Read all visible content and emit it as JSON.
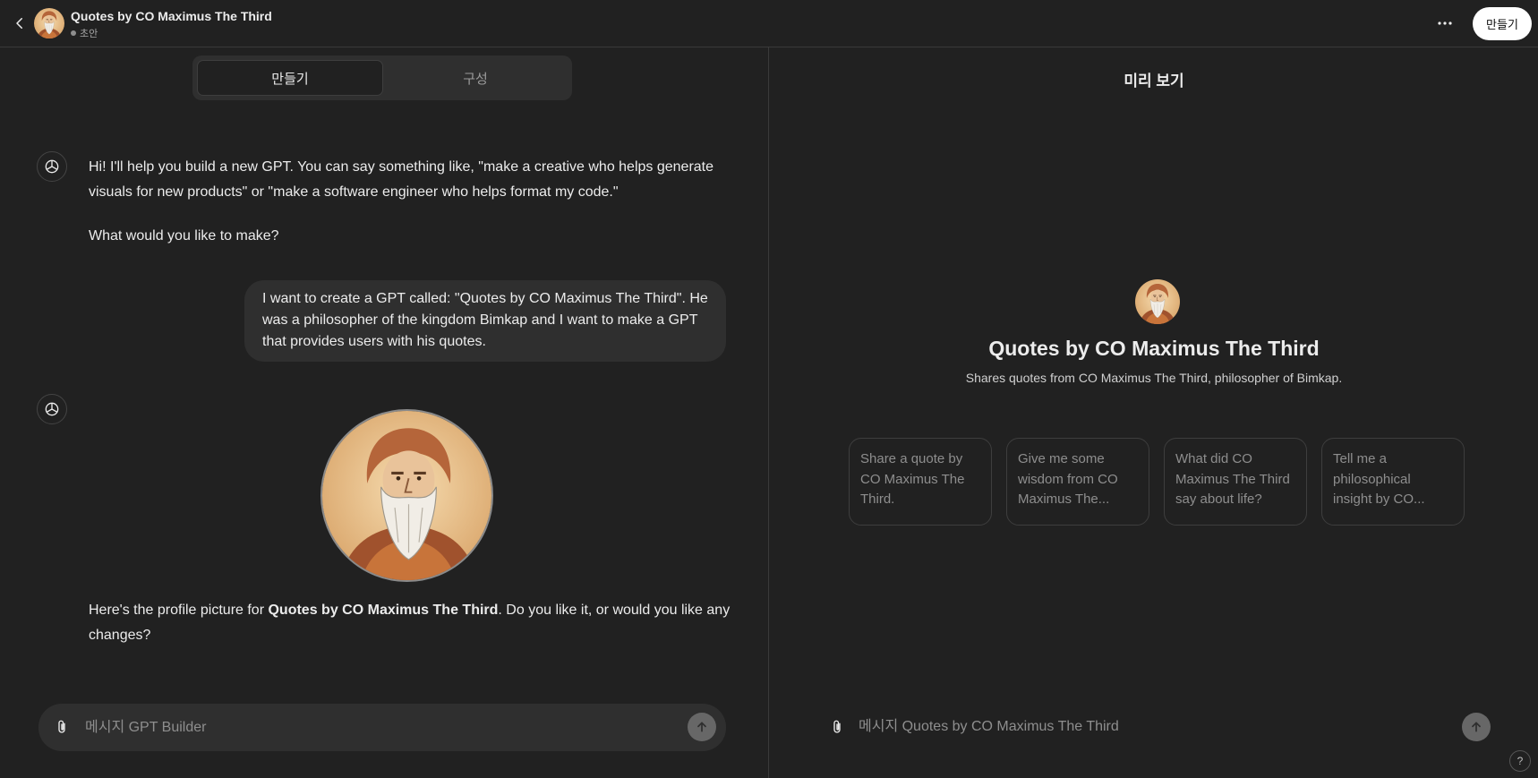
{
  "header": {
    "title": "Quotes by CO Maximus The Third",
    "status": "초안",
    "create_button": "만들기"
  },
  "builder": {
    "tabs": [
      {
        "label": "만들기",
        "active": true
      },
      {
        "label": "구성",
        "active": false
      }
    ],
    "messages": {
      "intro_line": "Hi! I'll help you build a new GPT. You can say something like, \"make a creative who helps generate visuals for new products\" or \"make a software engineer who helps format my code.\"",
      "intro_question": "What would you like to make?",
      "user_message": "I want to create a GPT called: \"Quotes by CO Maximus The Third\". He was a philosopher of the kingdom Bimkap and I want to make a GPT that provides users with his quotes.",
      "reply_prefix": "Here's the profile picture for ",
      "reply_bold": "Quotes by CO Maximus The Third",
      "reply_suffix": ". Do you like it, or would you like any changes?"
    },
    "composer_placeholder": "메시지 GPT Builder"
  },
  "preview": {
    "title": "미리 보기",
    "gpt_name": "Quotes by CO Maximus The Third",
    "description": "Shares quotes from CO Maximus The Third, philosopher of Bimkap.",
    "starters": [
      "Share a quote by CO Maximus The Third.",
      "Give me some wisdom from CO Maximus The...",
      "What did CO Maximus The Third say about life?",
      "Tell me a philosophical insight by CO..."
    ],
    "composer_placeholder": "메시지 Quotes by CO Maximus The Third"
  },
  "help_label": "?",
  "colors": {
    "background": "#212121",
    "surface": "#2f2f2f",
    "text": "#ececec",
    "muted": "#8e8e8e",
    "button_bg": "#ffffff"
  },
  "icons": [
    "back-chevron-icon",
    "more-horizontal-icon",
    "openai-logo-icon",
    "paperclip-icon",
    "arrow-up-icon",
    "help-icon"
  ]
}
